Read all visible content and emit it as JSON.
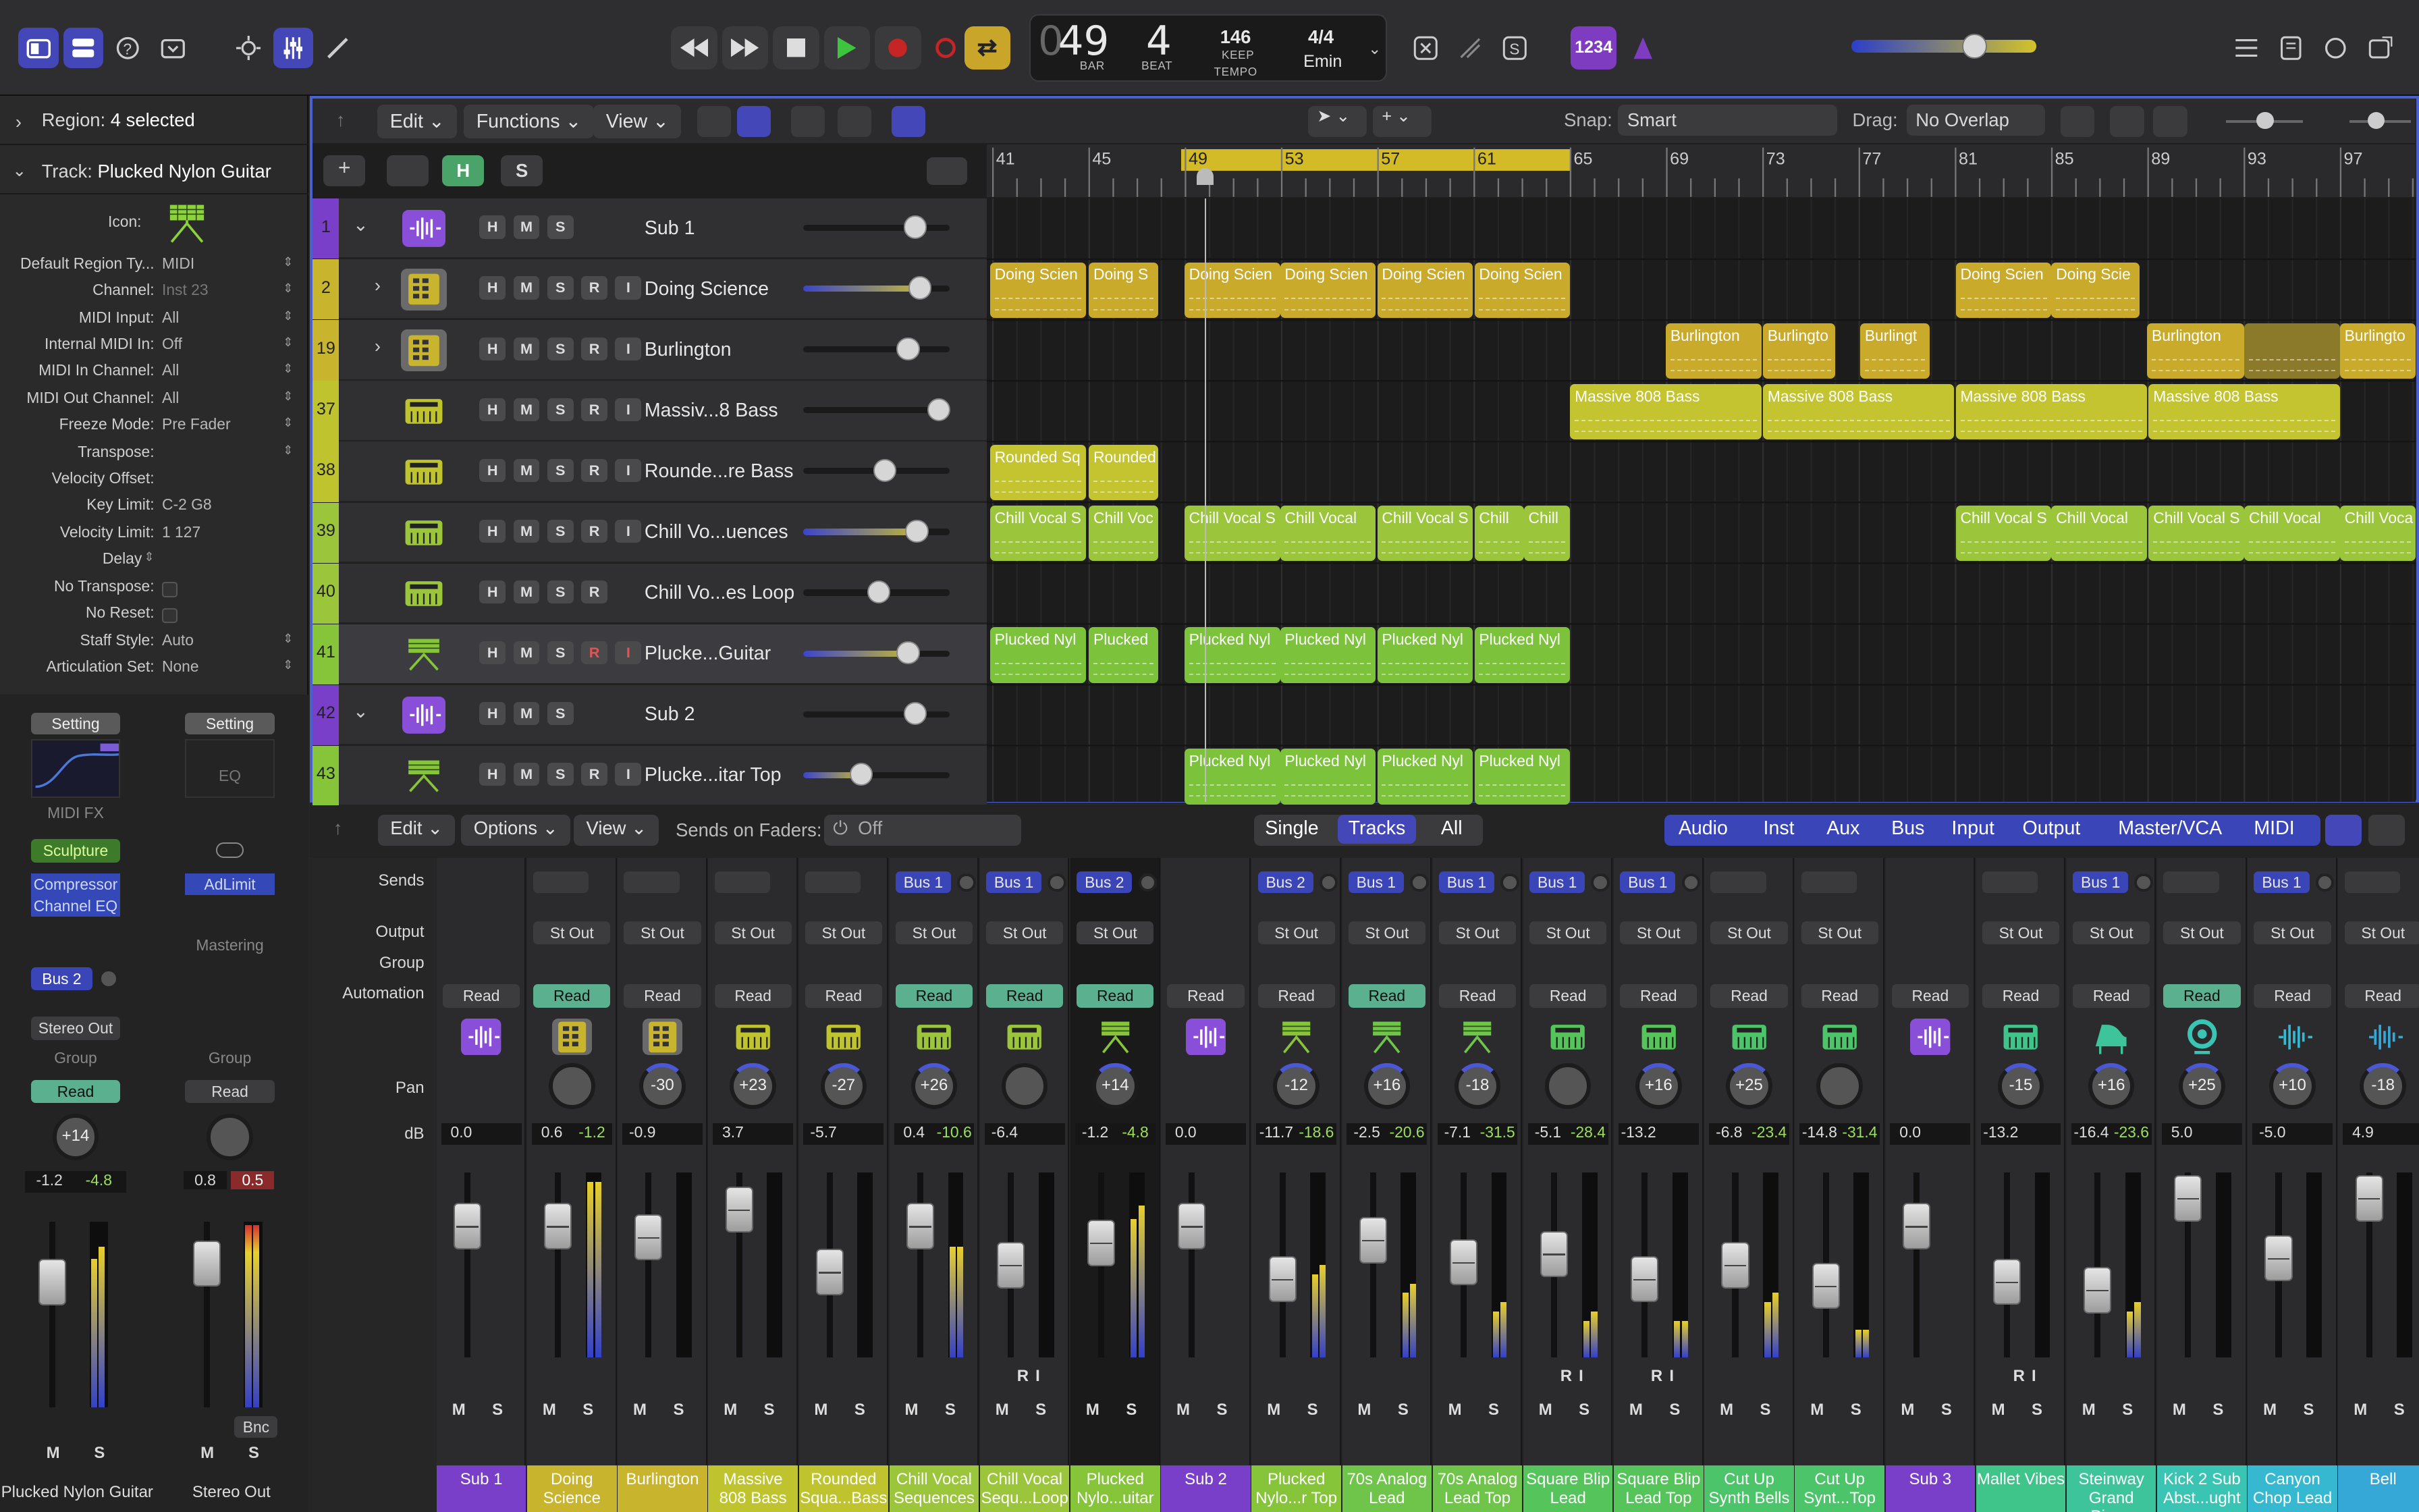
{
  "control_bar": {
    "lcd": {
      "bar": "49",
      "bar_label": "BAR",
      "beat": "4",
      "beat_label": "BEAT",
      "tempo": "146",
      "tempo_mode": "KEEP",
      "tempo_label": "TEMPO",
      "signature": "4/4",
      "key": "Emin"
    },
    "count_in": "1234"
  },
  "inspector": {
    "region_label": "Region:",
    "region_value": "4 selected",
    "track_label": "Track:",
    "track_value": "Plucked Nylon Guitar",
    "icon_label": "Icon:",
    "rows": [
      {
        "label": "Default Region Ty...",
        "value": "MIDI"
      },
      {
        "label": "Channel:",
        "value": "Inst 23"
      },
      {
        "label": "MIDI Input:",
        "value": "All"
      },
      {
        "label": "Internal MIDI In:",
        "value": "Off"
      },
      {
        "label": "MIDI In Channel:",
        "value": "All"
      },
      {
        "label": "MIDI Out Channel:",
        "value": "All"
      },
      {
        "label": "Freeze Mode:",
        "value": "Pre Fader"
      },
      {
        "label": "Transpose:",
        "value": ""
      },
      {
        "label": "Velocity Offset:",
        "value": ""
      },
      {
        "label": "Key Limit:",
        "value": "C-2  G8"
      },
      {
        "label": "Velocity Limit:",
        "value": "1  127"
      },
      {
        "label": "Delay",
        "value": ""
      },
      {
        "label": "No Transpose:",
        "value": ""
      },
      {
        "label": "No Reset:",
        "value": ""
      },
      {
        "label": "Staff Style:",
        "value": "Auto"
      },
      {
        "label": "Articulation Set:",
        "value": "None"
      }
    ],
    "strip1": {
      "setting": "Setting",
      "midifx": "MIDI FX",
      "plugins": [
        "Sculpture",
        "Compressor",
        "Channel EQ"
      ],
      "send": "Bus 2",
      "output": "Stereo Out",
      "group": "Group",
      "automation": "Read",
      "pan": "+14",
      "db": "-1.2",
      "peak": "-4.8",
      "m": "M",
      "s": "S",
      "name": "Plucked Nylon Guitar"
    },
    "strip2": {
      "setting": "Setting",
      "eq": "EQ",
      "plugins": [
        "AdLimit"
      ],
      "mastering": "Mastering",
      "group": "Group",
      "automation": "Read",
      "db": "0.8",
      "peak": "0.5",
      "bnc": "Bnc",
      "m": "M",
      "s": "S",
      "name": "Stereo Out"
    }
  },
  "tracks_toolbar": {
    "menus": [
      "Edit",
      "Functions",
      "View"
    ],
    "snap_label": "Snap:",
    "snap_value": "Smart",
    "drag_label": "Drag:",
    "drag_value": "No Overlap"
  },
  "header_buttons": {
    "h": "H",
    "s": "S",
    "m": "M",
    "r": "R",
    "i": "I"
  },
  "ruler": [
    "41",
    "45",
    "49",
    "53",
    "57",
    "61",
    "65",
    "69",
    "73",
    "77",
    "81",
    "85",
    "89",
    "93",
    "97"
  ],
  "tracks": [
    {
      "num": "1",
      "name": "Sub 1",
      "type": "sub",
      "color": "#7a3fc8",
      "stack": "Sub 1"
    },
    {
      "num": "2",
      "name": "Doing Science",
      "type": "drum",
      "color": "#c9b42e"
    },
    {
      "num": "19",
      "name": "Burlington",
      "type": "drum",
      "color": "#c9b42e"
    },
    {
      "num": "37",
      "name": "Massiv...8 Bass",
      "type": "synth",
      "color": "#bfc42e"
    },
    {
      "num": "38",
      "name": "Rounde...re Bass",
      "type": "synth",
      "color": "#bfc42e"
    },
    {
      "num": "39",
      "name": "Chill Vo...uences",
      "type": "synth",
      "color": "#9bc53a"
    },
    {
      "num": "40",
      "name": "Chill Vo...es Loop",
      "type": "synth",
      "color": "#9bc53a"
    },
    {
      "num": "41",
      "name": "Plucke...Guitar",
      "type": "guitar",
      "color": "#86c43a"
    },
    {
      "num": "42",
      "name": "Sub 2",
      "type": "sub",
      "color": "#7a3fc8",
      "stack": "Sub 2"
    },
    {
      "num": "43",
      "name": "Plucke...itar Top",
      "type": "guitar",
      "color": "#86c43a"
    }
  ],
  "regions": {
    "doing": [
      "Doing Scien",
      "Doing S",
      "Doing Scien",
      "Doing Scien",
      "Doing Scien",
      "Doing Scien",
      "Doing Scien",
      "Doing Scie"
    ],
    "burlington": [
      "Burlington",
      "Burlingto",
      "Burlingt",
      "Burlington",
      "Burlingto"
    ],
    "massive": [
      "Massive 808 Bass",
      "Massive 808 Bass",
      "Massive 808 Bass",
      "Massive 808 Bass"
    ],
    "rounded": [
      "Rounded Sq",
      "Rounded"
    ],
    "chill": [
      "Chill Vocal S",
      "Chill Voc",
      "Chill Vocal S",
      "Chill Vocal",
      "Chill Vocal S",
      "Chill",
      "Chill",
      "Chill Vocal S",
      "Chill Vocal",
      "Chill Vocal S",
      "Chill Vocal",
      "Chill Voca"
    ],
    "plucked": [
      "Plucked Nyl",
      "Plucked",
      "Plucked Nyl",
      "Plucked Nyl",
      "Plucked Nyl",
      "Plucked Nyl"
    ],
    "plucked_top": [
      "Plucked Nyl",
      "Plucked Nyl",
      "Plucked Nyl",
      "Plucked Nyl"
    ]
  },
  "mixer_toolbar": {
    "menus": [
      "Edit",
      "Options",
      "View"
    ],
    "sends_label": "Sends on Faders:",
    "sends_value": "Off",
    "views": [
      "Single",
      "Tracks",
      "All"
    ],
    "filters": [
      "Audio",
      "Inst",
      "Aux",
      "Bus",
      "Input",
      "Output",
      "Master/VCA",
      "MIDI"
    ],
    "row_labels": [
      "Sends",
      "Output",
      "Group",
      "Automation",
      "Pan",
      "dB"
    ]
  },
  "strips": [
    {
      "name": "Sub 1",
      "send": "",
      "out": "",
      "auto": "Read",
      "pan": "",
      "db": "0.0",
      "peak": "",
      "color": "#7a3fc8",
      "kind": "sub"
    },
    {
      "name": "Doing Science",
      "send": "",
      "out": "St Out",
      "auto": "Read",
      "pan": "",
      "db": "0.6",
      "peak": "-1.2",
      "color": "#c9b42e",
      "kind": "drum",
      "auto_on": true
    },
    {
      "name": "Burlington",
      "send": "",
      "out": "St Out",
      "auto": "Read",
      "pan": "-30",
      "db": "-0.9",
      "peak": "",
      "color": "#c9b42e",
      "kind": "drum"
    },
    {
      "name": "Massive 808 Bass",
      "send": "",
      "out": "St Out",
      "auto": "Read",
      "pan": "+23",
      "db": "3.7",
      "peak": "",
      "color": "#bfc42e",
      "kind": "synth"
    },
    {
      "name": "Rounded Squa...Bass",
      "send": "",
      "out": "St Out",
      "auto": "Read",
      "pan": "-27",
      "db": "-5.7",
      "peak": "",
      "color": "#bfc42e",
      "kind": "synth"
    },
    {
      "name": "Chill Vocal Sequences",
      "send": "Bus 1",
      "out": "St Out",
      "auto": "Read",
      "pan": "+26",
      "db": "0.4",
      "peak": "-10.6",
      "color": "#9bc53a",
      "kind": "synth",
      "auto_on": true
    },
    {
      "name": "Chill Vocal Sequ...Loop",
      "send": "Bus 1",
      "out": "St Out",
      "auto": "Read",
      "pan": "",
      "db": "-6.4",
      "peak": "",
      "color": "#9bc53a",
      "kind": "synth",
      "auto_on": true
    },
    {
      "name": "Plucked Nylo...uitar",
      "send": "Bus 2",
      "out": "St Out",
      "auto": "Read",
      "pan": "+14",
      "db": "-1.2",
      "peak": "-4.8",
      "color": "#86c43a",
      "kind": "guitar",
      "auto_on": true,
      "sel": true
    },
    {
      "name": "Sub 2",
      "send": "",
      "out": "",
      "auto": "Read",
      "pan": "",
      "db": "0.0",
      "peak": "",
      "color": "#7a3fc8",
      "kind": "sub"
    },
    {
      "name": "Plucked Nylo...r Top",
      "send": "Bus 2",
      "out": "St Out",
      "auto": "Read",
      "pan": "-12",
      "db": "-11.7",
      "peak": "-18.6",
      "color": "#86c43a",
      "kind": "guitar"
    },
    {
      "name": "70s Analog Lead",
      "send": "Bus 1",
      "out": "St Out",
      "auto": "Read",
      "pan": "+16",
      "db": "-2.5",
      "peak": "-20.6",
      "color": "#6fc44a",
      "kind": "guitar",
      "auto_on": true
    },
    {
      "name": "70s Analog Lead Top",
      "send": "Bus 1",
      "out": "St Out",
      "auto": "Read",
      "pan": "-18",
      "db": "-7.1",
      "peak": "-31.5",
      "color": "#6fc44a",
      "kind": "guitar"
    },
    {
      "name": "Square Blip Lead",
      "send": "Bus 1",
      "out": "St Out",
      "auto": "Read",
      "pan": "",
      "db": "-5.1",
      "peak": "-28.4",
      "color": "#55c45a",
      "kind": "keys"
    },
    {
      "name": "Square Blip Lead Top",
      "send": "Bus 1",
      "out": "St Out",
      "auto": "Read",
      "pan": "+16",
      "db": "-13.2",
      "peak": "",
      "color": "#55c45a",
      "kind": "keys"
    },
    {
      "name": "Cut Up Synth Bells",
      "send": "",
      "out": "St Out",
      "auto": "Read",
      "pan": "+25",
      "db": "-6.8",
      "peak": "-23.4",
      "color": "#4cc46a",
      "kind": "keys"
    },
    {
      "name": "Cut Up Synt...Top",
      "send": "",
      "out": "St Out",
      "auto": "Read",
      "pan": "",
      "db": "-14.8",
      "peak": "-31.4",
      "color": "#4cc46a",
      "kind": "keys"
    },
    {
      "name": "Sub 3",
      "send": "",
      "out": "",
      "auto": "Read",
      "pan": "",
      "db": "0.0",
      "peak": "",
      "color": "#7a3fc8",
      "kind": "sub"
    },
    {
      "name": "Mallet Vibes",
      "send": "",
      "out": "St Out",
      "auto": "Read",
      "pan": "-15",
      "db": "-13.2",
      "peak": "",
      "color": "#3fc48a",
      "kind": "keys"
    },
    {
      "name": "Steinway Grand Piano",
      "send": "Bus 1",
      "out": "St Out",
      "auto": "Read",
      "pan": "+16",
      "db": "-16.4",
      "peak": "-23.6",
      "color": "#3dc49a",
      "kind": "piano"
    },
    {
      "name": "Kick 2 Sub Abst...ught",
      "send": "",
      "out": "St Out",
      "auto": "Read",
      "pan": "+25",
      "db": "5.0",
      "peak": "",
      "color": "#39c4b4",
      "kind": "kick",
      "auto_on": true
    },
    {
      "name": "Canyon Chop Lead",
      "send": "Bus 1",
      "out": "St Out",
      "auto": "Read",
      "pan": "+10",
      "db": "-5.0",
      "peak": "",
      "color": "#35b8d0",
      "kind": "audio"
    },
    {
      "name": "Bell",
      "send": "",
      "out": "St Out",
      "auto": "Read",
      "pan": "-18",
      "db": "4.9",
      "peak": "",
      "color": "#35a8d8",
      "kind": "audio"
    }
  ]
}
